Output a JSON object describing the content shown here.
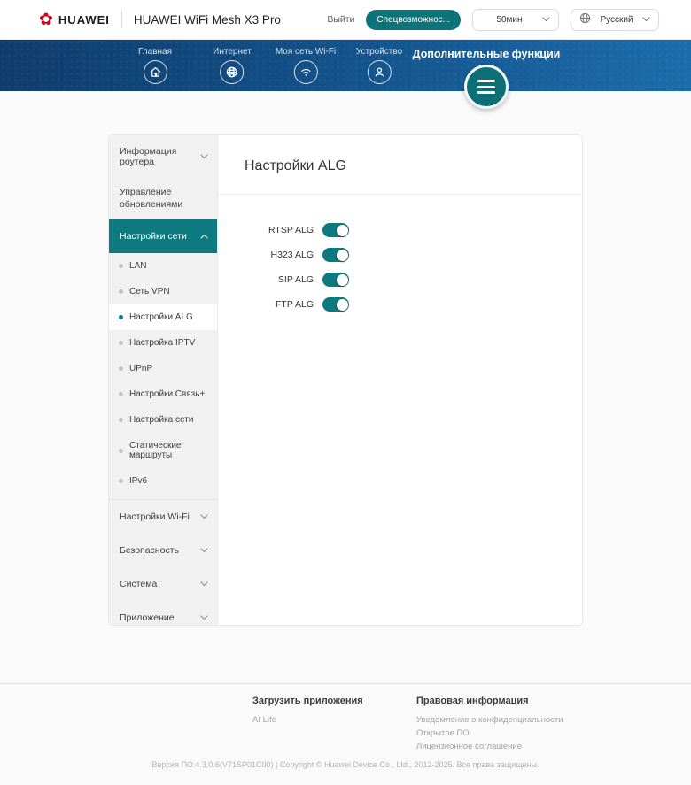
{
  "header": {
    "logo_text": "HUAWEI",
    "product_title": "HUAWEI WiFi Mesh X3 Pro",
    "logout_label": "Выйти",
    "accessibility_label": "Спецвозможнос...",
    "timeout_value": "50мин",
    "language_value": "Русский"
  },
  "nav": {
    "tabs": [
      {
        "label": "Главная",
        "icon": "home-icon"
      },
      {
        "label": "Интернет",
        "icon": "globe-icon"
      },
      {
        "label": "Моя сеть Wi-Fi",
        "icon": "wifi-icon"
      },
      {
        "label": "Устройство",
        "icon": "person-icon"
      }
    ],
    "advanced_label": "Дополнительные функции"
  },
  "sidebar": {
    "router_info": "Информация роутера",
    "update_mgmt": "Управление обновлениями",
    "network_settings": "Настройки сети",
    "subitems": [
      {
        "label": "LAN",
        "active": false
      },
      {
        "label": "Сеть VPN",
        "active": false
      },
      {
        "label": "Настройки ALG",
        "active": true
      },
      {
        "label": "Настройка IPTV",
        "active": false
      },
      {
        "label": "UPnP",
        "active": false
      },
      {
        "label": "Настройки Связь+",
        "active": false
      },
      {
        "label": "Настройка сети",
        "active": false
      },
      {
        "label": "Статические маршруты",
        "active": false
      },
      {
        "label": "IPv6",
        "active": false
      }
    ],
    "groups_bottom": [
      {
        "label": "Настройки Wi-Fi"
      },
      {
        "label": "Безопасность"
      },
      {
        "label": "Система"
      },
      {
        "label": "Приложение"
      }
    ]
  },
  "main": {
    "title": "Настройки ALG",
    "toggles": [
      {
        "label": "RTSP ALG",
        "state": "on"
      },
      {
        "label": "H323 ALG",
        "state": "on"
      },
      {
        "label": "SIP ALG",
        "state": "on"
      },
      {
        "label": "FTP ALG",
        "state": "on"
      }
    ]
  },
  "footer": {
    "apps_header": "Загрузить приложения",
    "apps_links": [
      {
        "label": "AI Life"
      }
    ],
    "legal_header": "Правовая информация",
    "legal_links": [
      {
        "label": "Уведомление о конфиденциальности"
      },
      {
        "label": "Открытое ПО"
      },
      {
        "label": "Лицензионное соглашение"
      }
    ],
    "version_line": "Версия ПО:4.3.0.6(V71SP01C00) | Copyright © Huawei Device Co., Ltd., 2012-2025. Все права защищены."
  },
  "colors": {
    "accent_teal": "#0c7a7e",
    "menu_circle_teal": "#0b6f75",
    "nav_gradient_start": "#0f3c6c",
    "nav_gradient_end": "#1c6dac",
    "huawei_red": "#d0021b"
  }
}
